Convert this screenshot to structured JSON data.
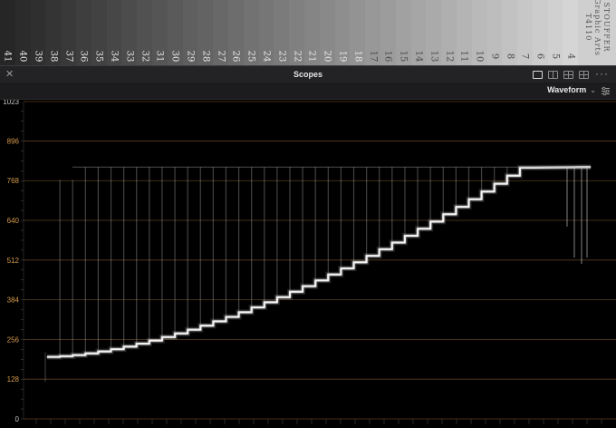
{
  "tablet": {
    "steps": [
      "41",
      "40",
      "39",
      "38",
      "37",
      "36",
      "35",
      "34",
      "33",
      "32",
      "31",
      "30",
      "29",
      "28",
      "27",
      "26",
      "25",
      "24",
      "23",
      "22",
      "21",
      "20",
      "19",
      "18",
      "17",
      "16",
      "15",
      "14",
      "13",
      "12",
      "11",
      "10",
      "9",
      "8",
      "7",
      "6",
      "5",
      "4"
    ],
    "brand_line1": "STOUFFER",
    "brand_line2": "Graphic Arts",
    "brand_line3": "T4110"
  },
  "panel": {
    "title": "Scopes",
    "close_icon": "close-icon",
    "layout_icons": [
      "single-view-icon",
      "dual-view-icon",
      "quad-view-icon",
      "quad-grid-icon"
    ],
    "more_icon": "more-options-icon"
  },
  "scope": {
    "mode": "Waveform",
    "mode_icon": "chevron-down-icon",
    "settings_icon": "scope-settings-icon",
    "scale_labels": [
      "1023",
      "896",
      "768",
      "640",
      "512",
      "384",
      "256",
      "128",
      "0"
    ],
    "scale_values": [
      1023,
      896,
      768,
      640,
      512,
      384,
      256,
      128,
      0
    ],
    "label_color": "#c8c8c8",
    "accent_label_color": "#d59a4a",
    "graticule_color": "#6a4a2a",
    "trace_color": "#ffffff"
  }
}
